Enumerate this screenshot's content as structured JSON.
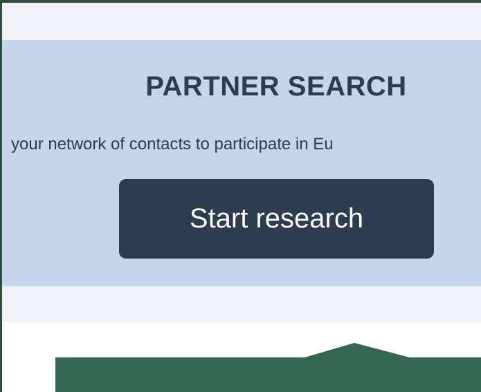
{
  "banner": {
    "title": "PARTNER SEARCH",
    "subtitle": "your network of contacts to participate in Eu",
    "button_label": "Start research"
  },
  "colors": {
    "banner_background": "#c5d6ec",
    "strip_background": "#eff1f6",
    "heading_text": "#2d3d4f",
    "button_background": "#2d3d4f",
    "button_text": "#ffffff",
    "green_panel": "#336653",
    "frame_border": "#2f4d3c"
  }
}
